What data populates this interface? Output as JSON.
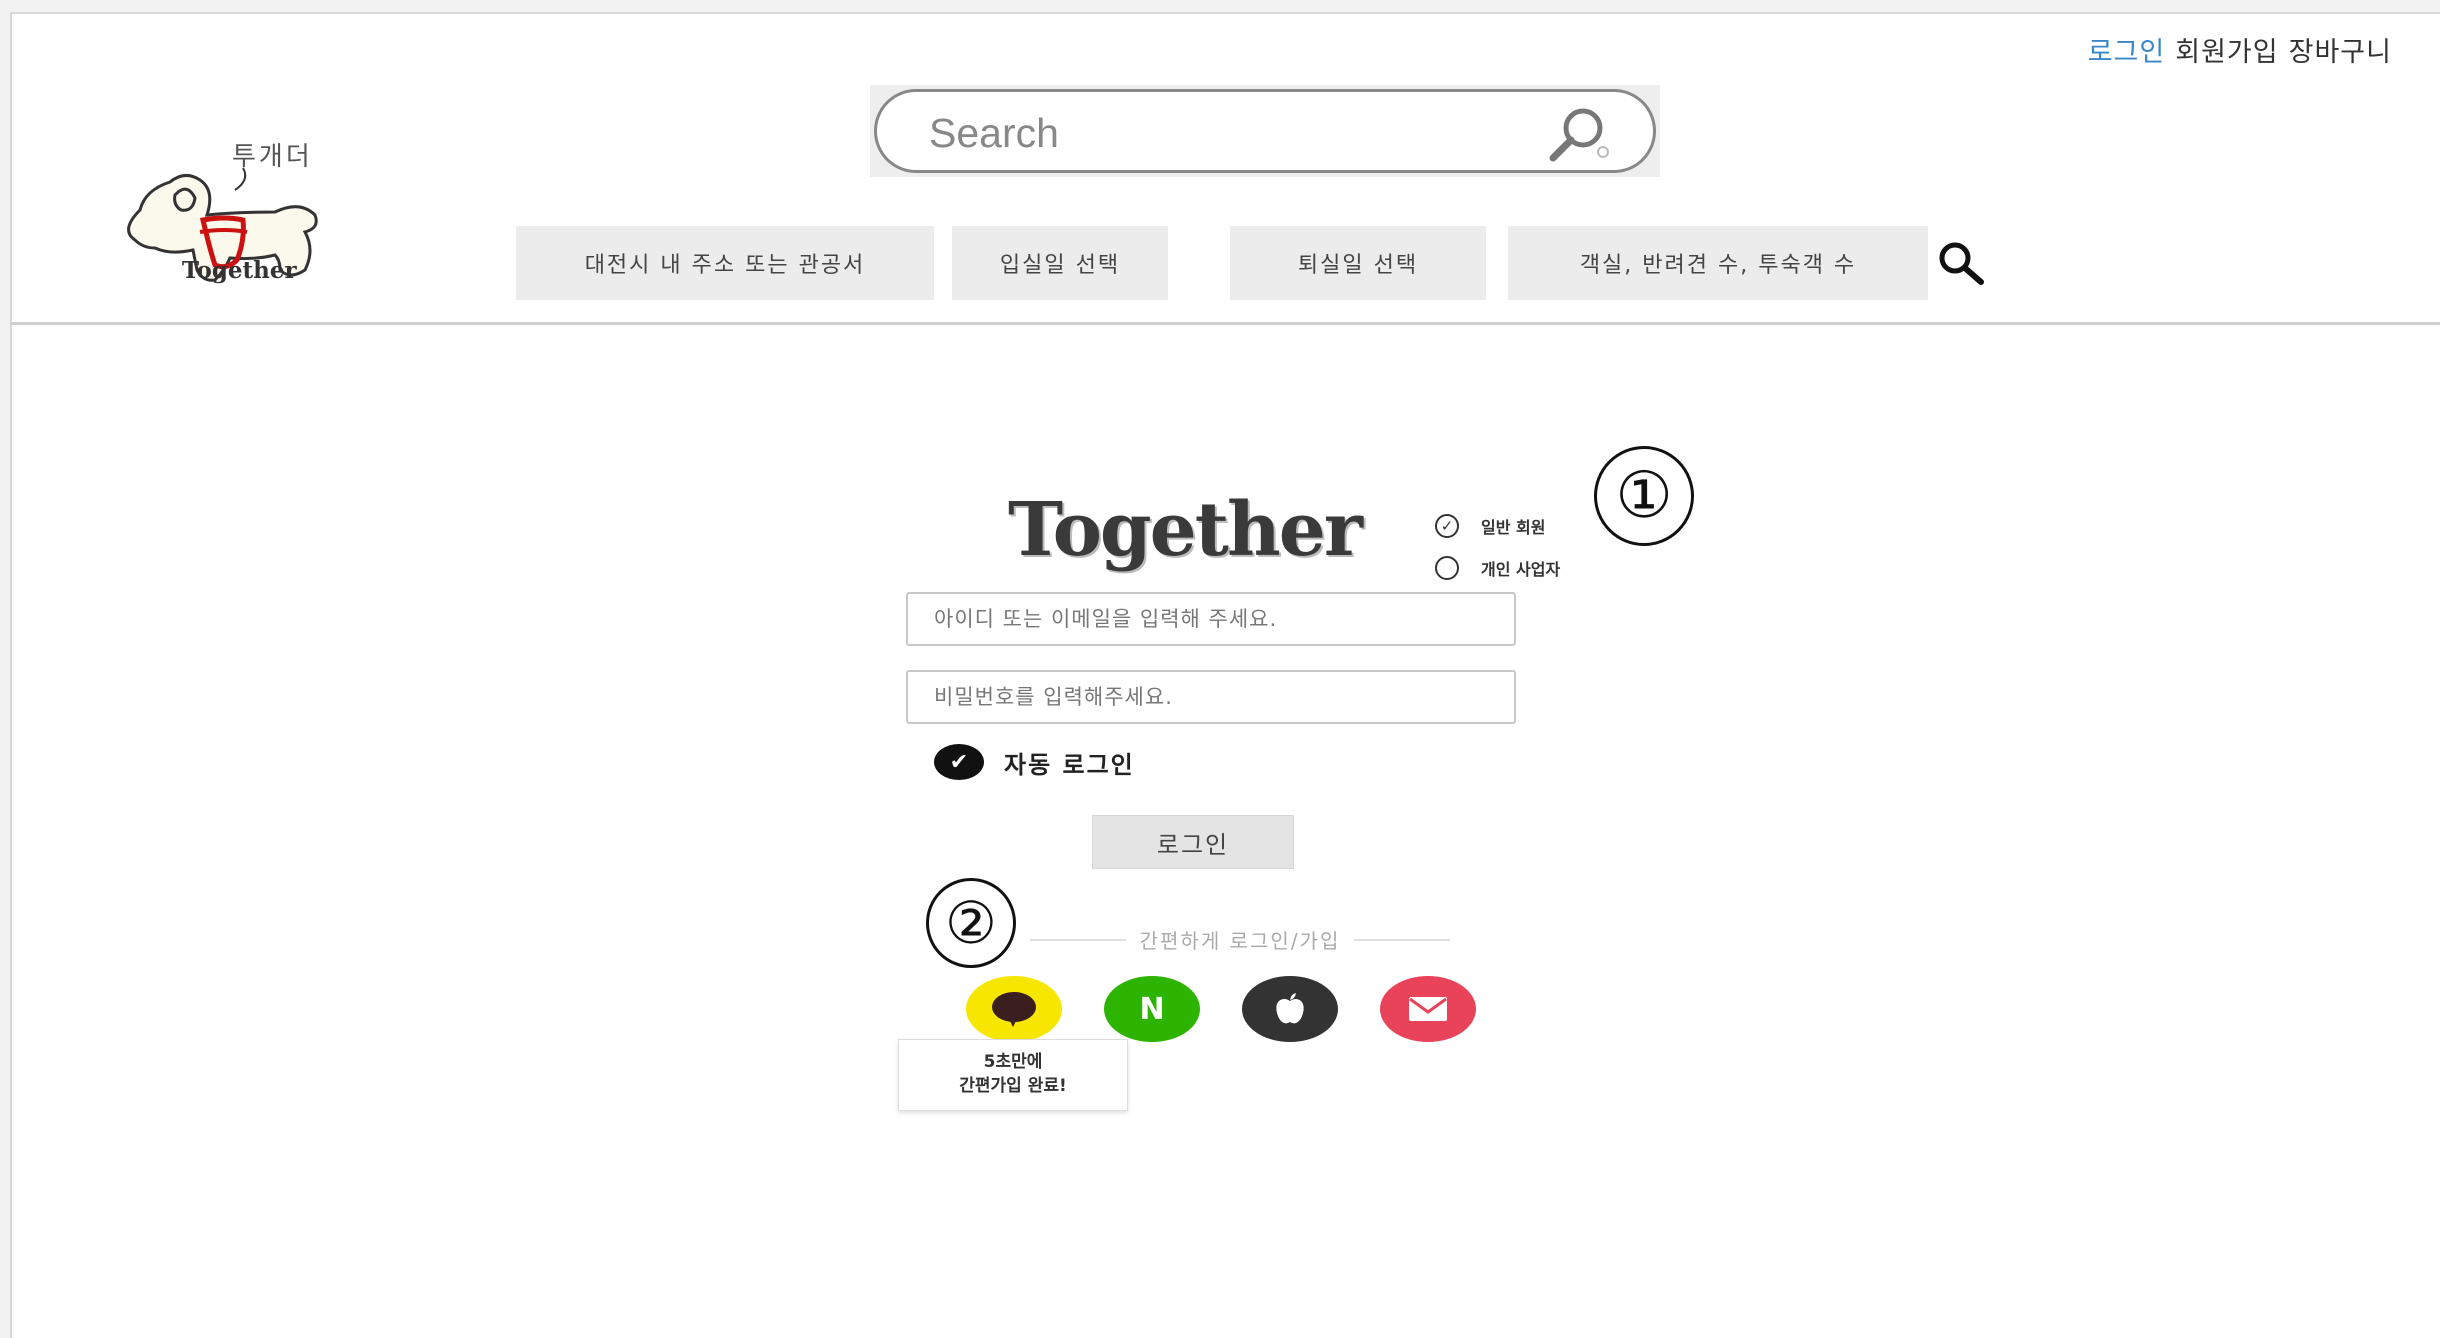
{
  "header": {
    "links": {
      "login": "로그인",
      "signup": "회원가입",
      "cart": "장바구니"
    },
    "logo": {
      "hangul": "투개더",
      "text": "Together"
    },
    "search": {
      "placeholder": "Search"
    },
    "filters": [
      {
        "label": "대전시 내 주소 또는 관공서"
      },
      {
        "label": "입실일 선택"
      },
      {
        "label": "퇴실일 선택"
      },
      {
        "label": "객실, 반려견 수, 투숙객 수"
      }
    ]
  },
  "login": {
    "brand": "Together",
    "member_types": [
      {
        "label": "일반 회원",
        "selected": true
      },
      {
        "label": "개인 사업자",
        "selected": false
      }
    ],
    "id_placeholder": "아이디 또는 이메일을 입력해 주세요.",
    "password_placeholder": "비밀번호를 입력해주세요.",
    "auto_login_label": "자동 로그인",
    "auto_login_checked": true,
    "login_button": "로그인",
    "easy_login_label": "간편하게 로그인/가입",
    "social": [
      {
        "name": "kakao",
        "icon": "speech-bubble-icon",
        "color": "#f7e600"
      },
      {
        "name": "naver",
        "icon": "naver-n-icon",
        "label": "N",
        "color": "#2db400"
      },
      {
        "name": "apple",
        "icon": "apple-icon",
        "color": "#333333"
      },
      {
        "name": "email",
        "icon": "envelope-icon",
        "color": "#e9435a"
      }
    ],
    "tooltip": {
      "line1": "5초만에",
      "line2": "간편가입 완료!"
    }
  },
  "annotations": {
    "marker1": "①",
    "marker2": "②"
  },
  "colors": {
    "link_blue": "#3a87c8",
    "filter_bg": "#ececec",
    "harness_red": "#cc1111"
  }
}
